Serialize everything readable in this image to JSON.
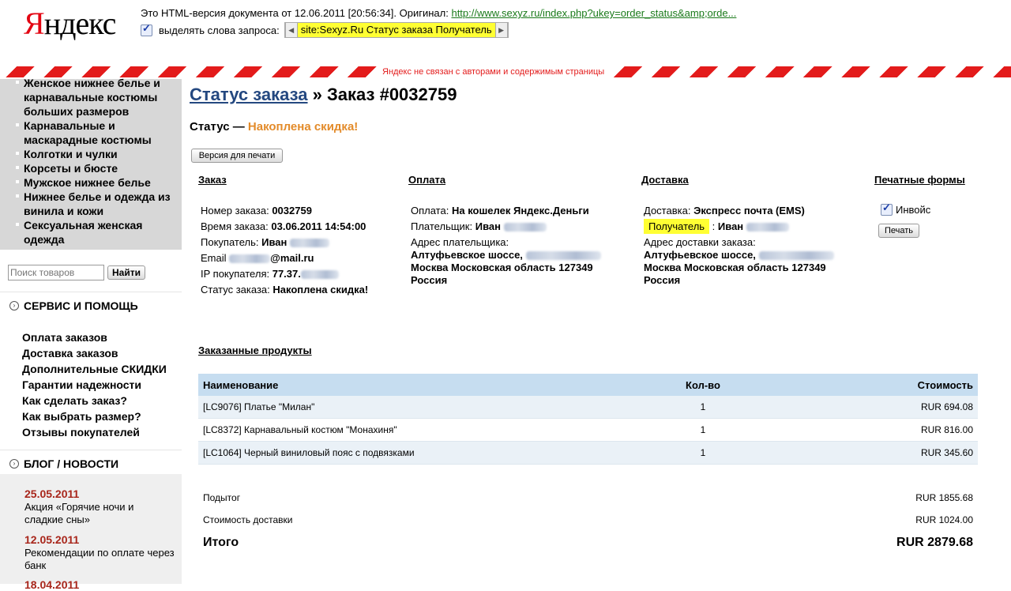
{
  "yandex": {
    "logo_first": "Я",
    "logo_rest": "ндекс",
    "cache_info": "Это HTML-версия документа от 12.06.2011 [20:56:34]. Оригинал:",
    "original_url": "http://www.sexyz.ru/index.php?ukey=order_status&amp;orde...",
    "highlight_label": "выделять слова запроса:",
    "query": "site:Sexyz.Ru Статус заказа Получатель",
    "disclaimer": "Яндекс не связан с авторами и содержимым страницы"
  },
  "sidebar": {
    "categories": [
      "Женское нижнее белье и карнавальные костюмы больших размеров",
      "Карнавальные и маскарадные костюмы",
      "Колготки и чулки",
      "Корсеты и бюсте",
      "Мужское нижнее белье",
      "Нижнее белье и одежда из винила и кожи",
      "Сексуальная женская одежда"
    ],
    "search_placeholder": "Поиск товаров",
    "search_button": "Найти",
    "service_title": "СЕРВИС И ПОМОЩЬ",
    "service_links": [
      "Оплата заказов",
      "Доставка заказов",
      "Дополнительные СКИДКИ",
      "Гарантии надежности",
      "Как сделать заказ?",
      "Как выбрать размер?",
      "Отзывы покупателей"
    ],
    "blog_title": "БЛОГ / НОВОСТИ",
    "news": [
      {
        "date": "25.05.2011",
        "text": "Акция «Горячие ночи и сладкие сны»"
      },
      {
        "date": "12.05.2011",
        "text": "Рекомендации по оплате через банк"
      },
      {
        "date": "18.04.2011",
        "text": ""
      }
    ]
  },
  "order": {
    "breadcrumb_link": "Статус заказа",
    "breadcrumb_sep": " » ",
    "title": "Заказ #0032759",
    "status_label": "Статус — ",
    "status_value": "Накоплена скидка!",
    "print_version": "Версия для печати",
    "col_order": "Заказ",
    "col_payment": "Оплата",
    "col_delivery": "Доставка",
    "col_forms": "Печатные формы",
    "number_label": "Номер заказа:",
    "number": "0032759",
    "time_label": "Время заказа:",
    "time": "03.06.2011 14:54:00",
    "buyer_label": "Покупатель:",
    "buyer": "Иван",
    "email_label": "Email",
    "email_domain": "@mail.ru",
    "ip_label": "IP покупателя:",
    "ip": "77.37.",
    "status2_label": "Статус заказа:",
    "status2": "Накоплена скидка!",
    "payment_label": "Оплата:",
    "payment": "На кошелек Яндекс.Деньги",
    "payer_label": "Плательщик:",
    "payer": "Иван",
    "payer_addr_label": "Адрес плательщика:",
    "payer_addr1": "Алтуфьевское шоссе,",
    "payer_addr2": "Москва Московская область 127349",
    "payer_addr3": "Россия",
    "delivery_label": "Доставка:",
    "delivery": "Экспресс почта (EMS)",
    "receiver_label": "Получатель",
    "receiver": "Иван",
    "delivery_addr_label": "Адрес доставки заказа:",
    "delivery_addr1": "Алтуфьевское шоссе,",
    "delivery_addr2": "Москва Московская область 127349",
    "delivery_addr3": "Россия",
    "invoice": "Инвойс",
    "print_button": "Печать"
  },
  "products": {
    "heading": "Заказанные продукты",
    "headers": {
      "name": "Наименование",
      "qty": "Кол-во",
      "cost": "Стоимость"
    },
    "rows": [
      {
        "name": "[LC9076] Платье \"Милан\"",
        "qty": "1",
        "cost": "RUR 694.08"
      },
      {
        "name": "[LC8372] Карнавальный костюм \"Монахиня\"",
        "qty": "1",
        "cost": "RUR 816.00"
      },
      {
        "name": "[LC1064] Черный виниловый пояс с подвязками",
        "qty": "1",
        "cost": "RUR 345.60"
      }
    ],
    "subtotal_label": "Подытог",
    "subtotal": "RUR 1855.68",
    "shipping_label": "Стоимость доставки",
    "shipping": "RUR 1024.00",
    "total_label": "Итого",
    "total": "RUR 2879.68"
  }
}
